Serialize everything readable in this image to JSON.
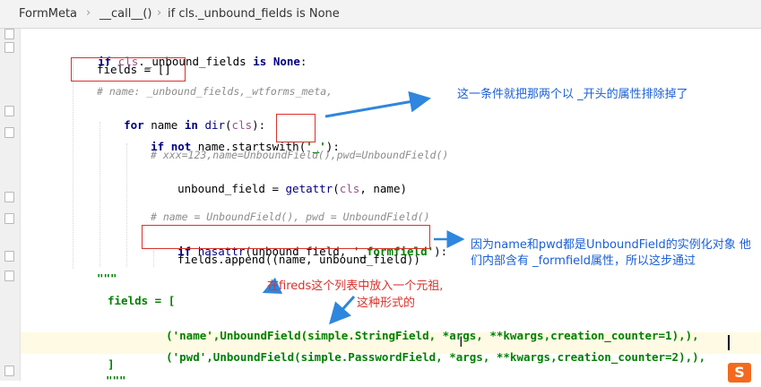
{
  "breadcrumb": [
    "FormMeta",
    "__call__()",
    "if cls._unbound_fields is None"
  ],
  "code": {
    "l1": {
      "kw1": "if",
      "cls": "cls",
      "rest": "._unbound_fields ",
      "kw2": "is",
      "kw3": "None",
      "colon": ":"
    },
    "l2": "fields = []",
    "l3": "# name: _unbound_fields,_wtforms_meta,",
    "l4": {
      "kw1": "for",
      "a": " name ",
      "kw2": "in",
      "b": " ",
      "bi": "dir",
      "c": "(",
      "cls": "cls",
      "d": "):"
    },
    "l5": {
      "kw1": "if",
      "kw2": "not",
      "a": " name.startswith(",
      "str": "'_'",
      "b": "):"
    },
    "l6": "# xxx=123,name=UnboundField(),pwd=UnboundField()",
    "l7": {
      "a": "unbound_field = ",
      "bi": "getattr",
      "b": "(",
      "cls": "cls",
      "c": ", name)"
    },
    "l8": "# name = UnboundField(), pwd = UnboundField()",
    "l9": {
      "kw": "if",
      "a": " ",
      "bi": "hasattr",
      "b": "(unbound_field, ",
      "str": "'_formfield'",
      "c": "):"
    },
    "l10": "fields.append((name, unbound_field))",
    "l11": "\"\"\"",
    "l12": "fields = [",
    "l13": {
      "s": "('name'",
      "a": ",UnboundField(simple.StringField, *args, **",
      "p1": "kwargs",
      "b": ",",
      "p2": "creation_counter",
      "c": "=1),),"
    },
    "l14": {
      "s": "('pwd'",
      "a": ",UnboundField(simple.PasswordField, *args, **",
      "p1": "kwargs",
      "b": ",",
      "p2": "creation_counter",
      "c": "=2),),"
    },
    "l15": "]",
    "l16": "\"\"\""
  },
  "annotations": {
    "a1": "这一条件就把那两个以 _开头的属性排除掉了",
    "a2": "因为name和pwd都是UnboundField的实例化对象   他们内部含有  _formfield属性，所以这步通过",
    "a3_line1": "在fireds这个列表中放入一个元祖,",
    "a3_line2": "这种形式的"
  },
  "logo": {
    "text": "S"
  },
  "colors": {
    "annotation_blue": "#1a5fd6",
    "annotation_red": "#d9312b",
    "box_red": "#d9312b",
    "arrow_blue": "#2e86de",
    "caret_line": "#fffae3"
  }
}
